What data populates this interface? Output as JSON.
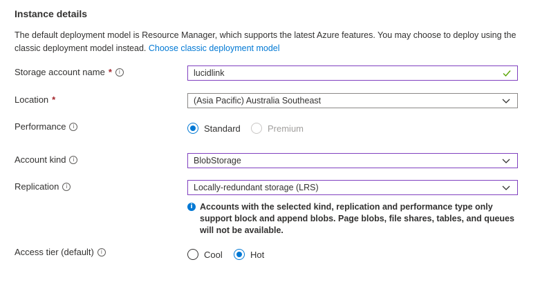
{
  "section": {
    "title": "Instance details",
    "description": "The default deployment model is Resource Manager, which supports the latest Azure features. You may choose to deploy using the classic deployment model instead.",
    "classic_link": "Choose classic deployment model"
  },
  "fields": {
    "storage_account_name": {
      "label": "Storage account name",
      "required": "*",
      "value": "lucidlink"
    },
    "location": {
      "label": "Location",
      "required": "*",
      "value": "(Asia Pacific) Australia Southeast"
    },
    "performance": {
      "label": "Performance",
      "options": [
        "Standard",
        "Premium"
      ],
      "selected": "Standard"
    },
    "account_kind": {
      "label": "Account kind",
      "value": "BlobStorage"
    },
    "replication": {
      "label": "Replication",
      "value": "Locally-redundant storage (LRS)",
      "note": "Accounts with the selected kind, replication and performance type only support block and append blobs. Page blobs, file shares, tables, and queues will not be available."
    },
    "access_tier": {
      "label": "Access tier (default)",
      "options": [
        "Cool",
        "Hot"
      ],
      "selected": "Hot"
    }
  },
  "colors": {
    "accent": "#0078d4",
    "focus_border": "#7f3fbf",
    "required": "#a4262c",
    "valid": "#57a300"
  },
  "icons": {
    "info": "info-icon",
    "check": "checkmark-icon",
    "chevron": "chevron-down-icon",
    "note": "info-filled-icon"
  }
}
